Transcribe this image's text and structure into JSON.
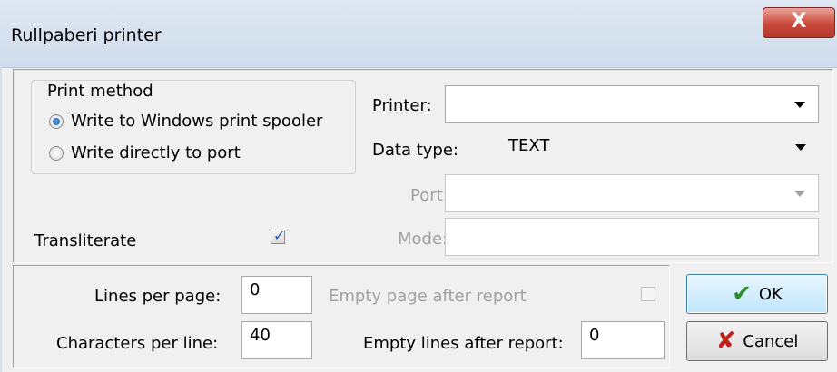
{
  "window": {
    "title": "Rullpaberi printer",
    "close_label": "X"
  },
  "print_method": {
    "legend": "Print method",
    "options": [
      {
        "label": "Write to Windows print spooler",
        "checked": true
      },
      {
        "label": "Write directly to port",
        "checked": false
      }
    ]
  },
  "printer": {
    "label": "Printer:",
    "value": ""
  },
  "data_type": {
    "label": "Data type:",
    "value": "TEXT"
  },
  "port": {
    "label": "Port:",
    "value": "",
    "enabled": false
  },
  "mode": {
    "label": "Mode:",
    "value": "",
    "enabled": false
  },
  "transliterate": {
    "label": "Transliterate",
    "checked": true
  },
  "lines_per_page": {
    "label": "Lines per page:",
    "value": "0"
  },
  "characters_per_line": {
    "label": "Characters per line:",
    "value": "40"
  },
  "empty_page_after_report": {
    "label": "Empty page after report",
    "checked": false,
    "enabled": false
  },
  "empty_lines_after_report": {
    "label": "Empty lines after report:",
    "value": "0"
  },
  "buttons": {
    "ok_label": "OK",
    "cancel_label": "Cancel"
  },
  "icons": {
    "ok": "checkmark-icon",
    "cancel": "x-mark-icon",
    "close": "close-icon"
  }
}
